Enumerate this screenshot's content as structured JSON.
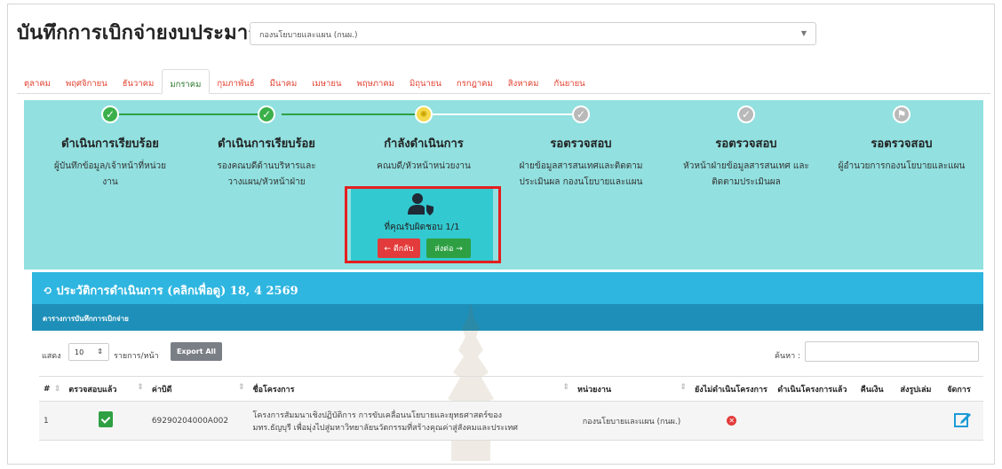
{
  "header": {
    "title": "บันทึกการเบิกจ่ายงบประมาณ",
    "unit_select_value": "กองนโยบายและแผน (กนผ.)"
  },
  "months": [
    {
      "label": "ตุลาคม",
      "active": false
    },
    {
      "label": "พฤศจิกายน",
      "active": false
    },
    {
      "label": "ธันวาคม",
      "active": false
    },
    {
      "label": "มกราคม",
      "active": true
    },
    {
      "label": "กุมภาพันธ์",
      "active": false
    },
    {
      "label": "มีนาคม",
      "active": false
    },
    {
      "label": "เมษายน",
      "active": false
    },
    {
      "label": "พฤษภาคม",
      "active": false
    },
    {
      "label": "มิถุนายน",
      "active": false
    },
    {
      "label": "กรกฎาคม",
      "active": false
    },
    {
      "label": "สิงหาคม",
      "active": false
    },
    {
      "label": "กันยายน",
      "active": false
    }
  ],
  "workflow": {
    "steps": [
      {
        "status": "done",
        "title": "ดำเนินการเรียบร้อย",
        "desc_line1": "ผู้บันทึกข้อมูล/เจ้าหน้าที่หน่วย",
        "desc_line2": "งาน"
      },
      {
        "status": "done",
        "title": "ดำเนินการเรียบร้อย",
        "desc_line1": "รองคณบดีด้านบริหารและ",
        "desc_line2": "วางแผน/หัวหน้าฝ่าย"
      },
      {
        "status": "current",
        "title": "กำลังดำเนินการ",
        "desc_line1": "คณบดี/หัวหน้าหน่วยงาน",
        "desc_line2": ""
      },
      {
        "status": "pending",
        "title": "รอตรวจสอบ",
        "desc_line1": "ฝ่ายข้อมูลสารสนเทศและติดตาม",
        "desc_line2": "ประเมินผล กองนโยบายและแผน"
      },
      {
        "status": "pending",
        "title": "รอตรวจสอบ",
        "desc_line1": "หัวหน้าฝ่ายข้อมูลสารสนเทศ และ",
        "desc_line2": "ติดตามประเมินผล"
      },
      {
        "status": "pending",
        "title": "รอตรวจสอบ",
        "desc_line1": "ผู้อำนวยการกองนโยบายและแผน",
        "desc_line2": ""
      }
    ],
    "responsibility": "ที่คุณรับผิดชอบ 1/1",
    "back_label": "← ตีกลับ",
    "send_label": "ส่งต่อ →"
  },
  "history": {
    "title": "ประวัติการดำเนินการ (คลิกเพื่อดู) 18, 4 2569",
    "sub_title": "ตารางการบันทึกการเบิกจ่าย"
  },
  "table_controls": {
    "show_label": "แสดง",
    "show_value": "10",
    "per_page_label": "รายการ/หน้า",
    "export_label": "Export All",
    "search_label": "ค้นหา :"
  },
  "table": {
    "headers": [
      "#",
      "ตรวจสอบแล้ว",
      "ค่าบิดี",
      "ชื่อโครงการ",
      "หน่วยงาน",
      "ยังไม่ดำเนินโครงการ",
      "ดำเนินโครงการแล้ว",
      "คืนเงิน",
      "ส่งรูปเล่ม",
      "จัดการ"
    ],
    "rows": [
      {
        "num": "1",
        "code": "69290204000A002",
        "project_line1": "โครงการสัมมนาเชิงปฏิบัติการ การขับเคลื่อนนโยบายและยุทธศาสตร์ของ",
        "project_line2": "มทร.ธัญบุรี เพื่อมุ่งไปสู่มหาวิทยาลัยนวัตกรรมที่สร้างคุณค่าสู่สังคมและประเทศ",
        "unit": "กองนโยบายและแผน (กนผ.)"
      }
    ]
  },
  "colors": {
    "workflow_bg": "#92e0e0",
    "done": "#3bb04a",
    "history_bar": "#2eb6e0",
    "highlight": "#e41f1f"
  }
}
